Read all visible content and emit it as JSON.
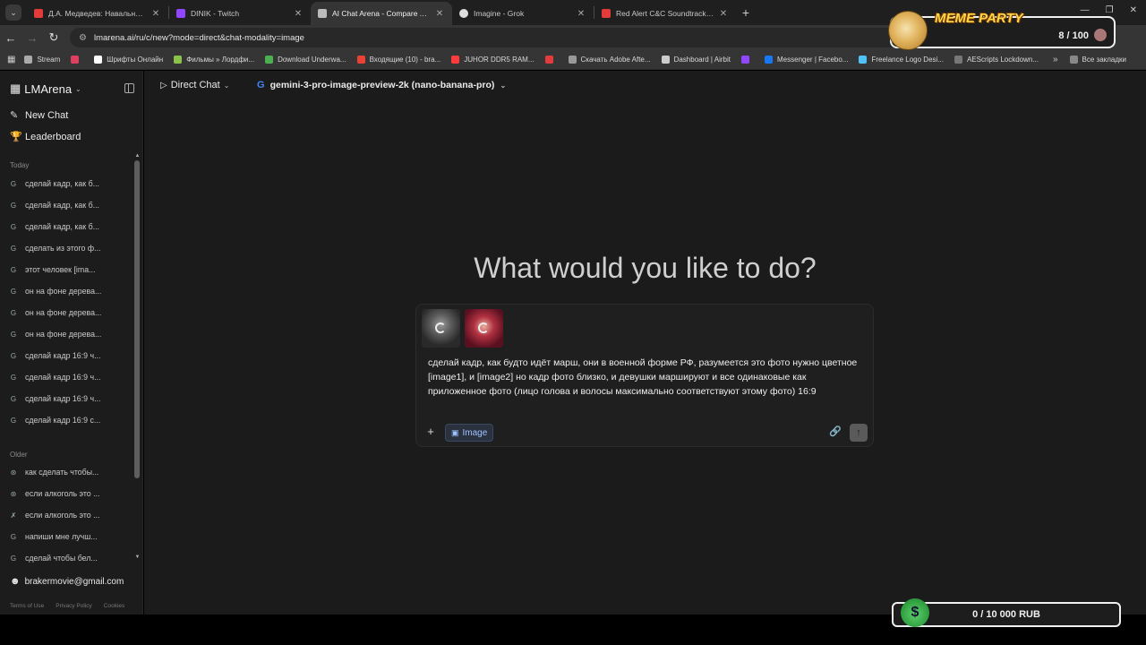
{
  "browser": {
    "tabs": [
      {
        "label": "Д.А. Медведев: Навальный, юрист",
        "favicon_color": "#e33b3b",
        "active": false
      },
      {
        "label": "DINIK - Twitch",
        "favicon_color": "#9146ff",
        "active": false
      },
      {
        "label": "AI Chat Arena - Compare AI Mo",
        "favicon_color": "#bbbbbb",
        "active": true
      },
      {
        "label": "Imagine - Grok",
        "favicon_color": "#dddddd",
        "active": false
      },
      {
        "label": "Red Alert C&C Soundtrack: Hell",
        "favicon_color": "#e33b3b",
        "active": false
      }
    ],
    "new_tab": "+",
    "url": "lmarena.ai/ru/c/new?mode=direct&chat-modality=image",
    "bookmarks": [
      {
        "label": "Stream",
        "color": "#aaaaaa"
      },
      {
        "label": "",
        "color": "#e04060"
      },
      {
        "label": "Шрифты Онлайн",
        "color": "#ffffff"
      },
      {
        "label": "Фильмы » Лордфи...",
        "color": "#8bc34a"
      },
      {
        "label": "Download Underwa...",
        "color": "#4caf50"
      },
      {
        "label": "Входящие (10) - bra...",
        "color": "#ea4335"
      },
      {
        "label": "JUHOR DDR5 RAM...",
        "color": "#ff3b3b"
      },
      {
        "label": "",
        "color": "#e33b3b"
      },
      {
        "label": "Скачать Adobe Afte...",
        "color": "#999999"
      },
      {
        "label": "Dashboard | Airbit",
        "color": "#cccccc"
      },
      {
        "label": "",
        "color": "#9146ff"
      },
      {
        "label": "Messenger | Facebo...",
        "color": "#1877f2"
      },
      {
        "label": "Freelance Logo Desi...",
        "color": "#4fc3f7"
      },
      {
        "label": "AEScripts Lockdown...",
        "color": "#777777"
      }
    ],
    "bookmarks_all": "Все закладки"
  },
  "sidebar": {
    "logo": "LMArena",
    "new_chat": "New Chat",
    "leaderboard": "Leaderboard",
    "today_label": "Today",
    "today_items": [
      "сделай кадр, как б...",
      "сделай кадр, как б...",
      "сделай кадр, как б...",
      "сделать из этого ф...",
      "этот человек [ima...",
      "он на фоне дерева...",
      "он на фоне дерева...",
      "он на фоне дерева...",
      "сделай кадр 16:9 ч...",
      "сделай кадр 16:9 ч...",
      "сделай кадр 16:9 ч...",
      "сделай кадр 16:9 с..."
    ],
    "older_label": "Older",
    "older_items": [
      "как сделать чтобы...",
      "если алкоголь это ...",
      "если алкоголь это ...",
      "напиши мне лучш...",
      "сделай чтобы бел..."
    ],
    "user_email": "brakermovie@gmail.com",
    "footer": [
      "Terms of Use",
      "Privacy Policy",
      "Cookies"
    ]
  },
  "main": {
    "mode": "Direct Chat",
    "model": "gemini-3-pro-image-preview-2k (nano-banana-pro)",
    "headline": "What would you like to do?",
    "prompt_text": "сделай кадр, как будто идёт марш, они в военной форме РФ, разумеется это фото нужно цветное [image1], и [image2] но кадр фото близко, и девушки маршируют и все одинаковые как приложенное фото (лицо голова и волосы максимально соответствуют этому фото) 16:9",
    "image_chip": "Image",
    "plus": "+"
  },
  "overlays": {
    "meme_title": "MEME PARTY",
    "meme_count": "8 / 100",
    "money": "0 / 10 000 RUB"
  }
}
